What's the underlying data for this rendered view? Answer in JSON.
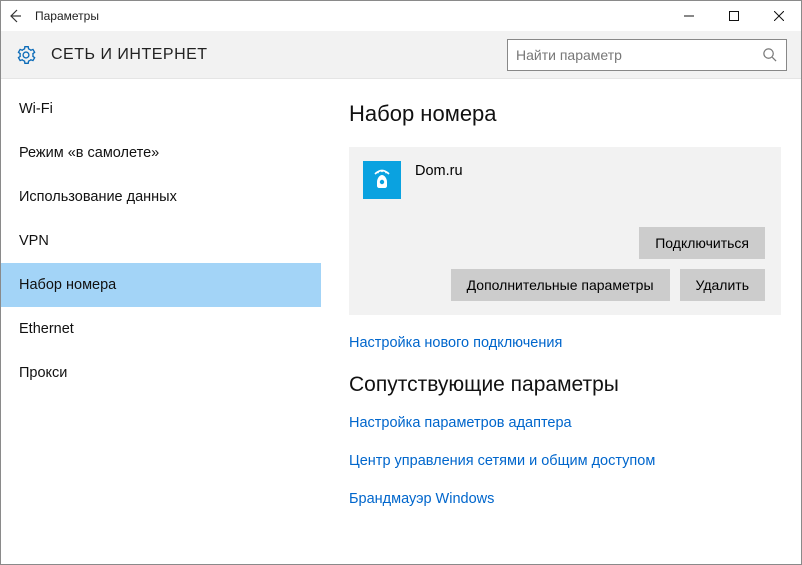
{
  "titlebar": {
    "title": "Параметры"
  },
  "header": {
    "title": "СЕТЬ И ИНТЕРНЕТ",
    "search_placeholder": "Найти параметр"
  },
  "sidebar": {
    "items": [
      {
        "label": "Wi-Fi",
        "selected": false
      },
      {
        "label": "Режим «в самолете»",
        "selected": false
      },
      {
        "label": "Использование данных",
        "selected": false
      },
      {
        "label": "VPN",
        "selected": false
      },
      {
        "label": "Набор номера",
        "selected": true
      },
      {
        "label": "Ethernet",
        "selected": false
      },
      {
        "label": "Прокси",
        "selected": false
      }
    ]
  },
  "main": {
    "section_title": "Набор номера",
    "connection": {
      "name": "Dom.ru",
      "connect_label": "Подключиться",
      "advanced_label": "Дополнительные параметры",
      "delete_label": "Удалить"
    },
    "new_connection_link": "Настройка нового подключения",
    "related": {
      "title": "Сопутствующие параметры",
      "links": [
        "Настройка параметров адаптера",
        "Центр управления сетями и общим доступом",
        "Брандмауэр Windows"
      ]
    }
  }
}
